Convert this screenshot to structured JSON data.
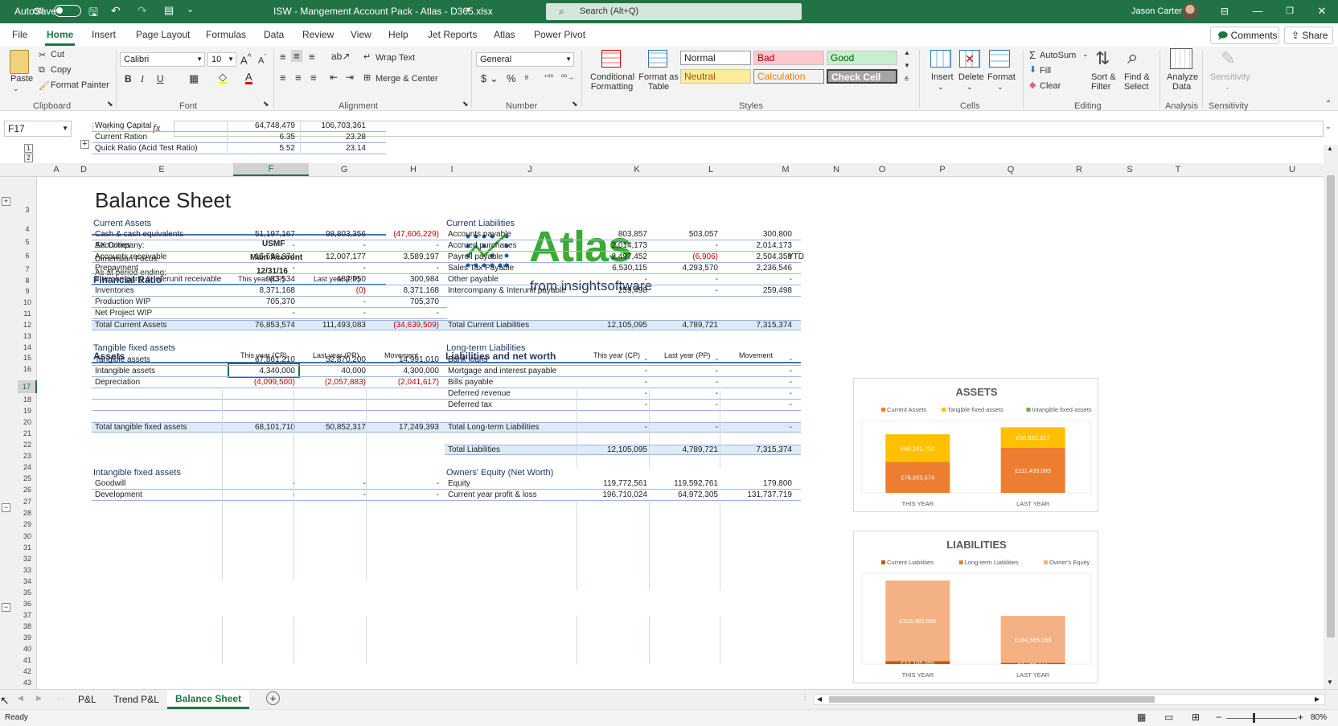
{
  "titlebar": {
    "autosave": "AutoSave",
    "autosave_state": "Off",
    "doc_title": "ISW - Mangement Account Pack - Atlas - D365.xlsx",
    "search_placeholder": "Search (Alt+Q)",
    "user": "Jason Carter"
  },
  "menu": {
    "tabs": [
      "File",
      "Home",
      "Insert",
      "Page Layout",
      "Formulas",
      "Data",
      "Review",
      "View",
      "Help",
      "Jet Reports",
      "Atlas",
      "Power Pivot"
    ],
    "comments": "Comments",
    "share": "Share"
  },
  "ribbon": {
    "paste": "Paste",
    "cut": "Cut",
    "copy": "Copy",
    "format_painter": "Format Painter",
    "clipboard": "Clipboard",
    "font_name": "Calibri",
    "font_size": "10",
    "font": "Font",
    "wrap_text": "Wrap Text",
    "merge_center": "Merge & Center",
    "alignment": "Alignment",
    "number_format": "General",
    "number": "Number",
    "conditional_formatting": [
      "Conditional",
      "Formatting"
    ],
    "format_as_table": [
      "Format as",
      "Table"
    ],
    "styles": "Styles",
    "style_normal": "Normal",
    "style_bad": "Bad",
    "style_good": "Good",
    "style_neutral": "Neutral",
    "style_calculation": "Calculation",
    "style_check_cell": "Check Cell",
    "insert": "Insert",
    "delete": "Delete",
    "format": "Format",
    "cells": "Cells",
    "autosum": "AutoSum",
    "fill": "Fill",
    "clear": "Clear",
    "sort_filter": [
      "Sort &",
      "Filter"
    ],
    "find_select": [
      "Find &",
      "Select"
    ],
    "editing": "Editing",
    "analyze_data": [
      "Analyze",
      "Data"
    ],
    "analysis": "Analysis",
    "sensitivity": "Sensitivity",
    "sensitivity_group": "Sensitivity",
    "bold": "B",
    "italic": "I",
    "underline": "U"
  },
  "formula": {
    "name_box": "F17",
    "fx": "fx",
    "value": ""
  },
  "columns": [
    "A",
    "D",
    "E",
    "F",
    "G",
    "H",
    "I",
    "J",
    "K",
    "L",
    "M",
    "N",
    "O",
    "P",
    "Q",
    "R",
    "S",
    "T",
    "U"
  ],
  "rows": [
    "3",
    "4",
    "5",
    "6",
    "7",
    "8",
    "9",
    "10",
    "11",
    "12",
    "13",
    "14",
    "15",
    "16",
    "17",
    "18",
    "19",
    "20",
    "21",
    "22",
    "23",
    "24",
    "25",
    "26",
    "27",
    "28",
    "29",
    "30",
    "31",
    "32",
    "33",
    "34",
    "35",
    "36",
    "37",
    "38",
    "39",
    "40",
    "41",
    "42",
    "43"
  ],
  "outline_levels": [
    "1",
    "2",
    "12"
  ],
  "sheet": {
    "title": "Balance Sheet",
    "info": [
      {
        "label": "AX Company:",
        "value": "USMF"
      },
      {
        "label": "Dimension Focus:",
        "value": "Main Account"
      },
      {
        "label": "As at period ending:",
        "value": "12/31/16"
      }
    ],
    "ytd": "YTD",
    "logo": {
      "name": "Atlas",
      "tagline": "from insightsoftware"
    },
    "ratio": {
      "title": "Financial Ratio",
      "col1": "This year (CP)",
      "col2": "Last year (PP)",
      "rows": [
        {
          "label": "Working Capital",
          "cp": "64,748,479",
          "pp": "106,703,361"
        },
        {
          "label": "Current Ration",
          "cp": "6.35",
          "pp": "23.28"
        },
        {
          "label": "Quick Ratio (Acid Test Ratio)",
          "cp": "5.52",
          "pp": "23.14"
        }
      ]
    },
    "assets": {
      "title": "Assets",
      "col1": "This year (CP)",
      "col2": "Last year (PP)",
      "col3": "Movement",
      "current": {
        "title": "Current Assets",
        "rows": [
          {
            "label": "Cash & cash equivalents",
            "cp": "51,197,167",
            "pp": "98,803,356",
            "mv": "(47,606,229)"
          },
          {
            "label": "Securities",
            "cp": "-",
            "pp": "-",
            "mv": "-"
          },
          {
            "label": "Accounts receivable",
            "cp": "15,596,374",
            "pp": "12,007,177",
            "mv": "3,589,197"
          },
          {
            "label": "Prepayment",
            "cp": "-",
            "pp": "-",
            "mv": "-"
          },
          {
            "label": "Intercompany & Interunit receivable",
            "cp": "983,534",
            "pp": "682,550",
            "mv": "300,984"
          },
          {
            "label": "Inventories",
            "cp": "8,371,168",
            "pp": "(0)",
            "mv": "8,371,168"
          },
          {
            "label": "Production WIP",
            "cp": "705,370",
            "pp": "-",
            "mv": "705,370"
          },
          {
            "label": "Net Project WIP",
            "cp": "-",
            "pp": "-",
            "mv": "-"
          }
        ],
        "total": {
          "label": "Total Current Assets",
          "cp": "76,853,574",
          "pp": "111,493,083",
          "mv": "(34,639,509)"
        }
      },
      "tangible": {
        "title": "Tangible fixed assets",
        "rows": [
          {
            "label": "Tangible assets",
            "cp": "67,861,210",
            "pp": "52,870,200",
            "mv": "14,991,010"
          },
          {
            "label": "Intangible assets",
            "cp": "4,340,000",
            "pp": "40,000",
            "mv": "4,300,000"
          },
          {
            "label": "Depreciation",
            "cp": "(4,099,500)",
            "pp": "(2,057,883)",
            "mv": "(2,041,617)"
          }
        ],
        "total": {
          "label": "Total tangible fixed assets",
          "cp": "68,101,710",
          "pp": "50,852,317",
          "mv": "17,249,393"
        }
      },
      "intangible": {
        "title": "Intangible fixed assets",
        "rows": [
          {
            "label": "Goodwill",
            "cp": "-",
            "pp": "-",
            "mv": "-"
          },
          {
            "label": "Development",
            "cp": "-",
            "pp": "-",
            "mv": "-"
          }
        ]
      }
    },
    "liabilities": {
      "title": "Liabilities and net worth",
      "col1": "This year (CP)",
      "col2": "Last year (PP)",
      "col3": "Movement",
      "current": {
        "title": "Current Liabilities",
        "rows": [
          {
            "label": "Accounts payable",
            "cp": "803,857",
            "pp": "503,057",
            "mv": "300,800"
          },
          {
            "label": "Accrued purchases",
            "cp": "2,014,173",
            "pp": "-",
            "mv": "2,014,173"
          },
          {
            "label": "Payroll payable",
            "cp": "2,497,452",
            "pp": "(6,906)",
            "mv": "2,504,358"
          },
          {
            "label": "Sales Tax Payable",
            "cp": "6,530,115",
            "pp": "4,293,570",
            "mv": "2,236,546"
          },
          {
            "label": "Other payable",
            "cp": "-",
            "pp": "-",
            "mv": "-"
          },
          {
            "label": "Intercompany & Interunit payable",
            "cp": "259,498",
            "pp": "-",
            "mv": "259,498"
          }
        ],
        "total": {
          "label": "Total Current Liabilities",
          "cp": "12,105,095",
          "pp": "4,789,721",
          "mv": "7,315,374"
        }
      },
      "longterm": {
        "title": "Long-term Liabilities",
        "rows": [
          {
            "label": "Bank loans",
            "cp": "-",
            "pp": "-",
            "mv": "-"
          },
          {
            "label": "Mortgage and interest payable",
            "cp": "-",
            "pp": "-",
            "mv": "-"
          },
          {
            "label": "Bills payable",
            "cp": "-",
            "pp": "-",
            "mv": "-"
          },
          {
            "label": "Deferred revenue",
            "cp": "-",
            "pp": "-",
            "mv": "-"
          },
          {
            "label": "Deferred tax",
            "cp": "-",
            "pp": "-",
            "mv": "-"
          }
        ],
        "total": {
          "label": "Total Long-term Liabilities",
          "cp": "-",
          "pp": "-",
          "mv": "-"
        }
      },
      "total": {
        "label": "Total Liabilities",
        "cp": "12,105,095",
        "pp": "4,789,721",
        "mv": "7,315,374"
      },
      "equity": {
        "title": "Owners' Equity (Net Worth)",
        "rows": [
          {
            "label": "Equity",
            "cp": "119,772,561",
            "pp": "119,592,761",
            "mv": "179,800"
          },
          {
            "label": "Current year profit & loss",
            "cp": "196,710,024",
            "pp": "64,972,305",
            "mv": "131,737,719"
          }
        ]
      }
    }
  },
  "chart_data": [
    {
      "type": "bar",
      "stacked": true,
      "title": "ASSETS",
      "categories": [
        "THIS YEAR",
        "LAST YEAR"
      ],
      "series": [
        {
          "name": "Current Assets",
          "color": "#ed7d31",
          "values": [
            76853574,
            111493083
          ],
          "labels": [
            "£76,853,574",
            "£111,493,083"
          ]
        },
        {
          "name": "Tangible fixed assets",
          "color": "#ffc000",
          "values": [
            68101710,
            50852317
          ],
          "labels": [
            "£68,101,710",
            "£50,852,317"
          ]
        },
        {
          "name": "Intangible fixed assets",
          "color": "#70ad47",
          "values": [
            0,
            0
          ],
          "labels": [
            "",
            ""
          ]
        }
      ],
      "legend": "top",
      "grid": false
    },
    {
      "type": "bar",
      "stacked": true,
      "title": "LIABILITIES",
      "categories": [
        "THIS YEAR",
        "LAST YEAR"
      ],
      "series": [
        {
          "name": "Current Liabilities",
          "color": "#c55a11",
          "values": [
            12105095,
            4789721
          ],
          "labels": [
            "£12,105,095",
            "£4,789,721"
          ]
        },
        {
          "name": "Long-term Liabilities",
          "color": "#ed7d31",
          "values": [
            0,
            0
          ],
          "labels": [
            "",
            ""
          ]
        },
        {
          "name": "Owner's Equity",
          "color": "#f4b183",
          "values": [
            316482585,
            184565066
          ],
          "labels": [
            "£316,482,585",
            "£184,565,066"
          ]
        }
      ],
      "legend": "top",
      "grid": false
    }
  ],
  "tabs": {
    "sheets": [
      "P&L",
      "Trend P&L",
      "Balance Sheet"
    ],
    "active": "Balance Sheet"
  },
  "status": {
    "ready": "Ready",
    "zoom": "80%"
  }
}
